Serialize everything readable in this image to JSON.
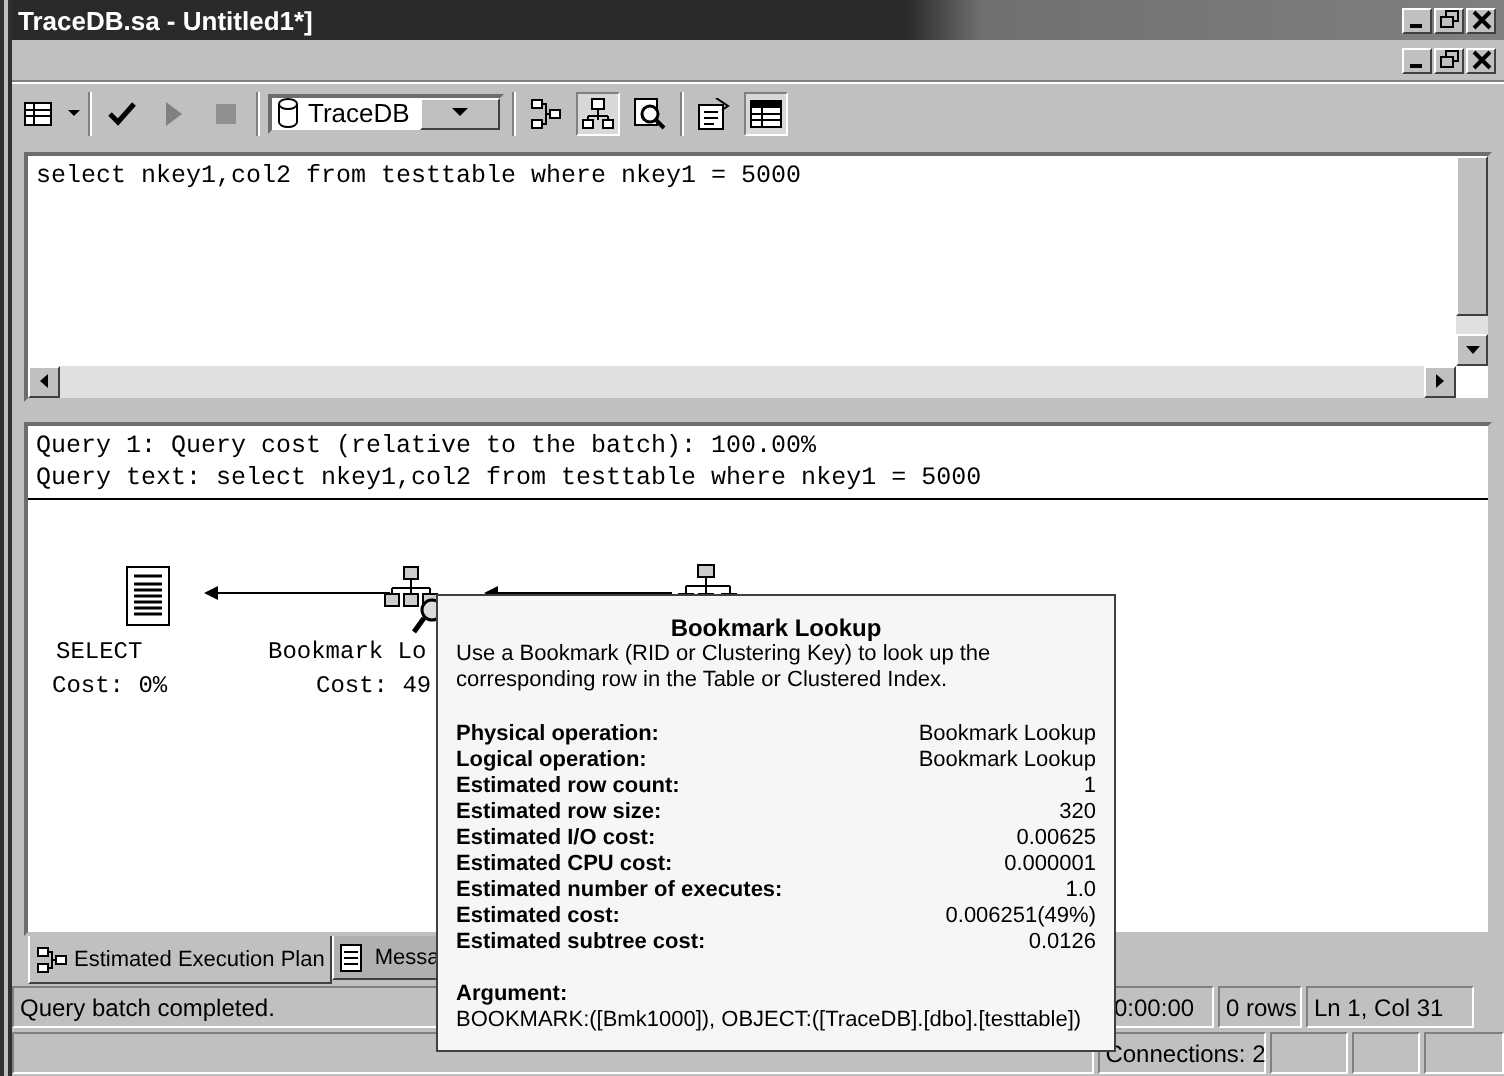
{
  "window": {
    "title": "TraceDB.sa - Untitled1*]"
  },
  "toolbar": {
    "database": "TraceDB",
    "run_disabled": true,
    "stop_disabled": true
  },
  "editor": {
    "text": "select nkey1,col2 from testtable where nkey1 = 5000"
  },
  "results": {
    "lines": [
      "Query 1: Query cost (relative to the batch): 100.00%",
      "Query text: select nkey1,col2 from testtable where nkey1 = 5000"
    ]
  },
  "plan": {
    "nodes": [
      {
        "kind": "select",
        "name": "SELECT",
        "cost": "Cost: 0%"
      },
      {
        "kind": "lookup",
        "name": "Bookmark Lo",
        "cost": "Cost: 49"
      },
      {
        "kind": "seek"
      }
    ]
  },
  "tooltip": {
    "title": "Bookmark Lookup",
    "description": "Use a Bookmark (RID or Clustering Key) to look up the corresponding row in the Table or Clustered Index.",
    "properties": [
      {
        "label": "Physical operation:",
        "value": "Bookmark Lookup"
      },
      {
        "label": "Logical operation:",
        "value": "Bookmark Lookup"
      },
      {
        "label": "Estimated row count:",
        "value": "1"
      },
      {
        "label": "Estimated row size:",
        "value": "320"
      },
      {
        "label": "Estimated I/O cost:",
        "value": "0.00625"
      },
      {
        "label": "Estimated CPU cost:",
        "value": "0.000001"
      },
      {
        "label": "Estimated number of executes:",
        "value": "1.0"
      },
      {
        "label": "Estimated cost:",
        "value": "0.006251(49%)"
      },
      {
        "label": "Estimated subtree cost:",
        "value": "0.0126"
      }
    ],
    "argument_label": "Argument:",
    "argument": "BOOKMARK:([Bmk1000]), OBJECT:([TraceDB].[dbo].[testtable])"
  },
  "tabs": [
    {
      "label": "Estimated Execution Plan",
      "selected": true
    },
    {
      "label": "Messa",
      "selected": false
    }
  ],
  "status_bar": {
    "message": "Query batch completed.",
    "time": "0:00:00",
    "rows": "0 rows",
    "position": "Ln 1, Col 31",
    "connections": "Connections: 2"
  }
}
